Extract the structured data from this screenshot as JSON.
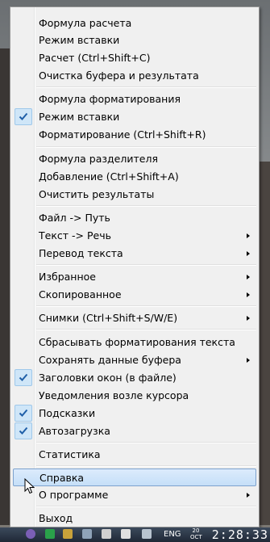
{
  "menu": {
    "items": [
      {
        "label": "Формула расчета",
        "checked": false,
        "submenu": false,
        "highlighted": false
      },
      {
        "label": "Режим вставки",
        "checked": false,
        "submenu": false,
        "highlighted": false
      },
      {
        "label": "Расчет (Ctrl+Shift+C)",
        "checked": false,
        "submenu": false,
        "highlighted": false
      },
      {
        "label": "Очистка буфера и результата",
        "checked": false,
        "submenu": false,
        "highlighted": false
      },
      {
        "label": "Формула форматирования",
        "checked": false,
        "submenu": false,
        "highlighted": false
      },
      {
        "label": "Режим вставки",
        "checked": true,
        "submenu": false,
        "highlighted": false
      },
      {
        "label": "Форматирование (Ctrl+Shift+R)",
        "checked": false,
        "submenu": false,
        "highlighted": false
      },
      {
        "label": "Формула разделителя",
        "checked": false,
        "submenu": false,
        "highlighted": false
      },
      {
        "label": "Добавление (Ctrl+Shift+A)",
        "checked": false,
        "submenu": false,
        "highlighted": false
      },
      {
        "label": "Очистить результаты",
        "checked": false,
        "submenu": false,
        "highlighted": false
      },
      {
        "label": "Файл -> Путь",
        "checked": false,
        "submenu": false,
        "highlighted": false
      },
      {
        "label": "Текст -> Речь",
        "checked": false,
        "submenu": true,
        "highlighted": false
      },
      {
        "label": "Перевод текста",
        "checked": false,
        "submenu": true,
        "highlighted": false
      },
      {
        "label": "Избранное",
        "checked": false,
        "submenu": true,
        "highlighted": false
      },
      {
        "label": "Скопированное",
        "checked": false,
        "submenu": true,
        "highlighted": false
      },
      {
        "label": "Снимки (Ctrl+Shift+S/W/E)",
        "checked": false,
        "submenu": true,
        "highlighted": false
      },
      {
        "label": "Сбрасывать форматирования текста",
        "checked": false,
        "submenu": false,
        "highlighted": false
      },
      {
        "label": "Сохранять данные буфера",
        "checked": false,
        "submenu": true,
        "highlighted": false
      },
      {
        "label": "Заголовки окон (в файле)",
        "checked": true,
        "submenu": false,
        "highlighted": false
      },
      {
        "label": "Уведомления возле курсора",
        "checked": false,
        "submenu": false,
        "highlighted": false
      },
      {
        "label": "Подсказки",
        "checked": true,
        "submenu": false,
        "highlighted": false
      },
      {
        "label": "Автозагрузка",
        "checked": true,
        "submenu": false,
        "highlighted": false
      },
      {
        "label": "Статистика",
        "checked": false,
        "submenu": false,
        "highlighted": false
      },
      {
        "label": "Справка",
        "checked": false,
        "submenu": false,
        "highlighted": true
      },
      {
        "label": "О программе",
        "checked": false,
        "submenu": true,
        "highlighted": false
      },
      {
        "label": "Выход",
        "checked": false,
        "submenu": false,
        "highlighted": false
      }
    ]
  },
  "taskbar": {
    "language": "ENG",
    "date_day": "20",
    "date_month": "OCT",
    "clock": "2:28:33"
  },
  "colors": {
    "menu_bg": "#f0f0f0",
    "highlight": "#c5dff8",
    "check_bg": "#cfe6f8",
    "check_mark": "#1f5fa8"
  }
}
